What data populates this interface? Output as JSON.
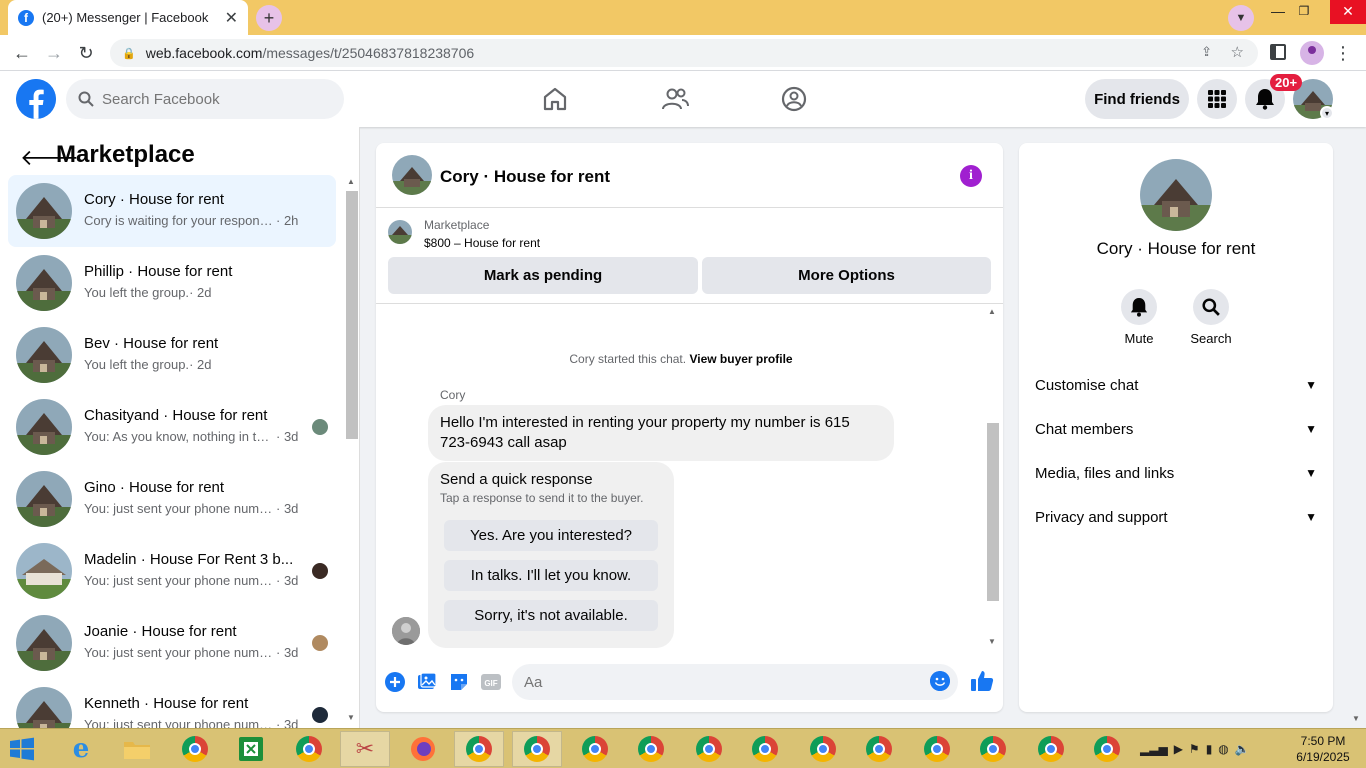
{
  "browser": {
    "tab_title": "(20+) Messenger | Facebook",
    "tab_favicon": "f",
    "url_domain": "web.facebook.com",
    "url_path": "/messages/t/25046837818238706"
  },
  "fb_header": {
    "search_placeholder": "Search Facebook",
    "find_friends_label": "Find friends",
    "notification_count": "20+"
  },
  "left": {
    "title": "Marketplace",
    "conversations": [
      {
        "name": "Cory · House for rent",
        "preview": "Cory is waiting for your response.",
        "time": "· 2h",
        "active": true
      },
      {
        "name": "Phillip · House for rent",
        "preview": "You left the group.",
        "time": "· 2d"
      },
      {
        "name": "Bev · House for rent",
        "preview": "You left the group.",
        "time": "· 2d"
      },
      {
        "name": "Chasityand · House for rent",
        "preview": "You: As you know, nothing in thi...",
        "time": "· 3d"
      },
      {
        "name": "Gino · House for rent",
        "preview": "You: just sent your phone number ...",
        "time": "· 3d"
      },
      {
        "name": "Madelin · House For Rent 3 b...",
        "preview": "You: just sent your phone numb...",
        "time": "· 3d"
      },
      {
        "name": "Joanie · House for rent",
        "preview": "You: just sent your phone numb...",
        "time": "· 3d"
      },
      {
        "name": "Kenneth · House for rent",
        "preview": "You: just sent your phone numb...",
        "time": "· 3d"
      }
    ]
  },
  "chat": {
    "title": "Cory · House for rent",
    "marketplace_label": "Marketplace",
    "listing": "$800 – House for rent",
    "mark_pending_label": "Mark as pending",
    "more_options_label": "More Options",
    "started_text": "Cory started this chat.",
    "view_profile_link": "View buyer profile",
    "sender_name": "Cory",
    "message": "Hello I'm interested in renting your property my number is 615 723-6943 call asap",
    "quick_title": "Send a quick response",
    "quick_subtitle": "Tap a response to send it to the buyer.",
    "quick_responses": [
      "Yes. Are you interested?",
      "In talks. I'll let you know.",
      "Sorry, it's not available."
    ],
    "input_placeholder": "Aa"
  },
  "right": {
    "name": "Cory · House for rent",
    "mute_label": "Mute",
    "search_label": "Search",
    "sections": [
      "Customise chat",
      "Chat members",
      "Media, files and links",
      "Privacy and support"
    ]
  },
  "taskbar": {
    "time": "7:50 PM",
    "date": "6/19/2025"
  },
  "colors": {
    "facebook_blue": "#1877f2",
    "active_conversation": "#ebf5ff",
    "info_purple": "#a020d0",
    "browser_frame": "#f2c865",
    "taskbar": "#d9c274"
  }
}
